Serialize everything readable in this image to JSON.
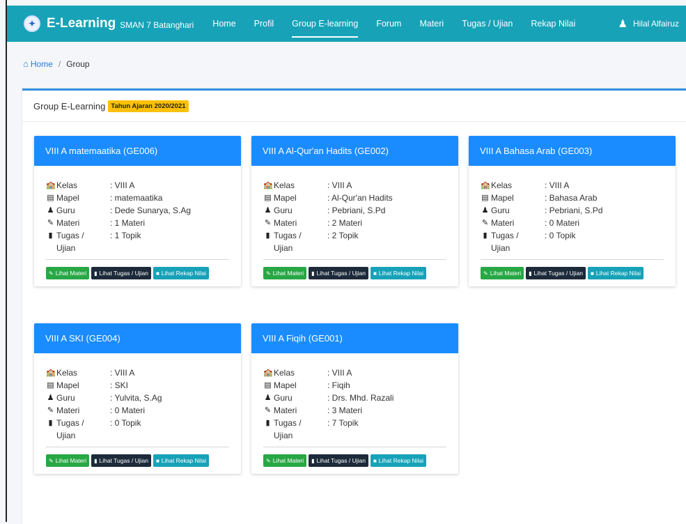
{
  "brand": {
    "logo_text": "✦",
    "name": "E-Learning",
    "school": "SMAN 7 Batanghari"
  },
  "nav": {
    "items": [
      {
        "label": "Home",
        "active": false
      },
      {
        "label": "Profil",
        "active": false
      },
      {
        "label": "Group E-learning",
        "active": true
      },
      {
        "label": "Forum",
        "active": false
      },
      {
        "label": "Materi",
        "active": false
      },
      {
        "label": "Tugas / Ujian",
        "active": false
      },
      {
        "label": "Rekap Nilai",
        "active": false
      }
    ],
    "user": "Hilal Alfairuz"
  },
  "breadcrumb": {
    "home": "Home",
    "separator": "/",
    "current": "Group"
  },
  "panel": {
    "title": "Group E-Learning",
    "badge": "Tahun Ajaran 2020/2021"
  },
  "labels": {
    "kelas": "Kelas",
    "mapel": "Mapel",
    "guru": "Guru",
    "materi": "Materi",
    "tugas": "Tugas / Ujian",
    "btn_materi": "Lihat Materi",
    "btn_tugas": "Lihat Tugas / Ujian",
    "btn_rekap": "Lihat Rekap Nilai"
  },
  "groups": [
    {
      "title": "VIII A matemaatika (GE006)",
      "kelas": ": VIII A",
      "mapel": ": matemaatika",
      "guru": ": Dede Sunarya, S.Ag",
      "materi": ": 1 Materi",
      "tugas": ": 1 Topik"
    },
    {
      "title": "VIII A Al-Qur'an Hadits (GE002)",
      "kelas": ": VIII A",
      "mapel": ": Al-Qur'an Hadits",
      "guru": ": Pebriani, S.Pd",
      "materi": ": 2 Materi",
      "tugas": ": 2 Topik"
    },
    {
      "title": "VIII A Bahasa Arab (GE003)",
      "kelas": ": VIII A",
      "mapel": ": Bahasa Arab",
      "guru": ": Pebriani, S.Pd",
      "materi": ": 0 Materi",
      "tugas": ": 0 Topik"
    },
    {
      "title": "VIII A SKI (GE004)",
      "kelas": ": VIII A",
      "mapel": ": SKI",
      "guru": ": Yulvita, S.Ag",
      "materi": ": 0 Materi",
      "tugas": ": 0 Topik"
    },
    {
      "title": "VIII A Fiqih (GE001)",
      "kelas": ": VIII A",
      "mapel": ": Fiqih",
      "guru": ": Drs. Mhd. Razali",
      "materi": ": 3 Materi",
      "tugas": ": 7 Topik"
    }
  ],
  "colors": {
    "navbar": "#17a2b8",
    "card_header": "#1a8cff",
    "btn_materi": "#28a745",
    "btn_tugas": "#1c2a3a",
    "btn_rekap": "#17a2b8",
    "badge": "#ffc107"
  }
}
